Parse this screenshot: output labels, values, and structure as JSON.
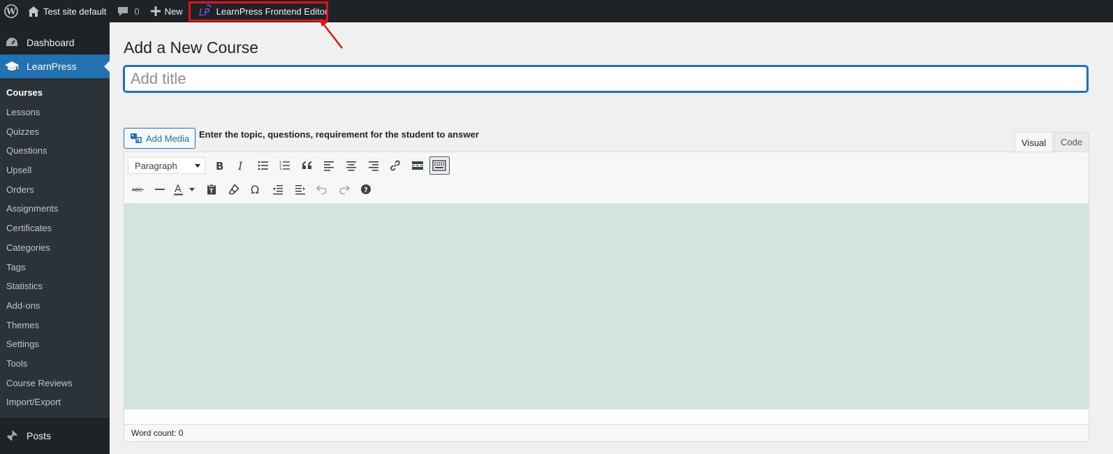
{
  "adminbar": {
    "site_name": "Test site default",
    "comments_count": "0",
    "new_label": "New",
    "plugin_label": "LearnPress Frontend Editor"
  },
  "sidebar": {
    "dashboard": "Dashboard",
    "learnpress": "LearnPress",
    "submenu": [
      "Courses",
      "Lessons",
      "Quizzes",
      "Questions",
      "Upsell",
      "Orders",
      "Assignments",
      "Certificates",
      "Categories",
      "Tags",
      "Statistics",
      "Add-ons",
      "Themes",
      "Settings",
      "Tools",
      "Course Reviews",
      "Import/Export"
    ],
    "posts": "Posts"
  },
  "page": {
    "title": "Add a New Course",
    "title_placeholder": "Add title"
  },
  "editor": {
    "add_media": "Add Media",
    "helper_text": "Enter the topic, questions, requirement for the student to answer",
    "tab_visual": "Visual",
    "tab_code": "Code",
    "format_value": "Paragraph",
    "word_count": "Word count: 0"
  },
  "colors": {
    "adminbar_bg": "#1d2327",
    "accent": "#2271b1",
    "highlight": "#e3121b",
    "editor_bg": "#d2e4de"
  }
}
